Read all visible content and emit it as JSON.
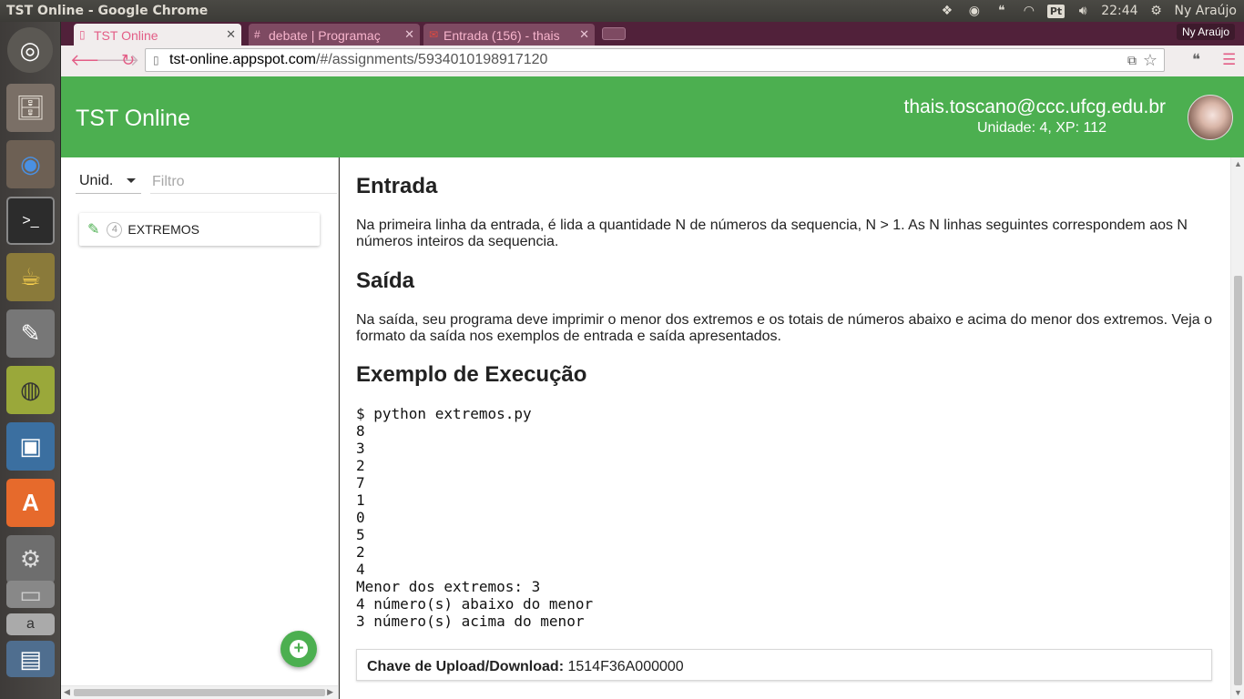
{
  "window_title": "TST Online - Google Chrome",
  "system_tray": {
    "input_method": "Pt",
    "clock": "22:44",
    "user": "Ny Araújo"
  },
  "browser": {
    "profile_name": "Ny Araújo",
    "tabs": [
      {
        "label": "TST Online",
        "favicon": "page-icon",
        "active": true
      },
      {
        "label": "debate | Programaç",
        "favicon": "hash-icon",
        "active": false
      },
      {
        "label": "Entrada (156) - thais",
        "favicon": "gmail-icon",
        "active": false
      }
    ],
    "url_host": "tst-online.appspot.com",
    "url_path": "/#/assignments/5934010198917120"
  },
  "app": {
    "title": "TST Online",
    "user_email": "thais.toscano@ccc.ufcg.edu.br",
    "user_info": "Unidade: 4, XP: 112"
  },
  "sidebar": {
    "unit_select": "Unid.",
    "filter_placeholder": "Filtro",
    "assignments": [
      {
        "unit": "4",
        "name": "EXTREMOS"
      }
    ]
  },
  "main": {
    "section_entrada_title": "Entrada",
    "section_entrada_text": "Na primeira linha da entrada, é lida a quantidade N de números da sequencia, N > 1. As N linhas seguintes correspondem aos N números inteiros da sequencia.",
    "section_saida_title": "Saída",
    "section_saida_text": "Na saída, seu programa deve imprimir o menor dos extremos e os totais de números abaixo e acima do menor dos extremos. Veja o formato da saída nos exemplos de entrada e saída apresentados.",
    "section_exemplo_title": "Exemplo de Execução",
    "example_code": "$ python extremos.py\n8\n3\n2\n7\n1\n0\n5\n2\n4\nMenor dos extremos: 3\n4 número(s) abaixo do menor\n3 número(s) acima do menor",
    "key_label": "Chave de Upload/Download:",
    "key_value": "1514F36A000000"
  },
  "colors": {
    "header_green": "#4caf50",
    "chrome_frame": "#51213a",
    "tab_accent": "#e35d86"
  }
}
